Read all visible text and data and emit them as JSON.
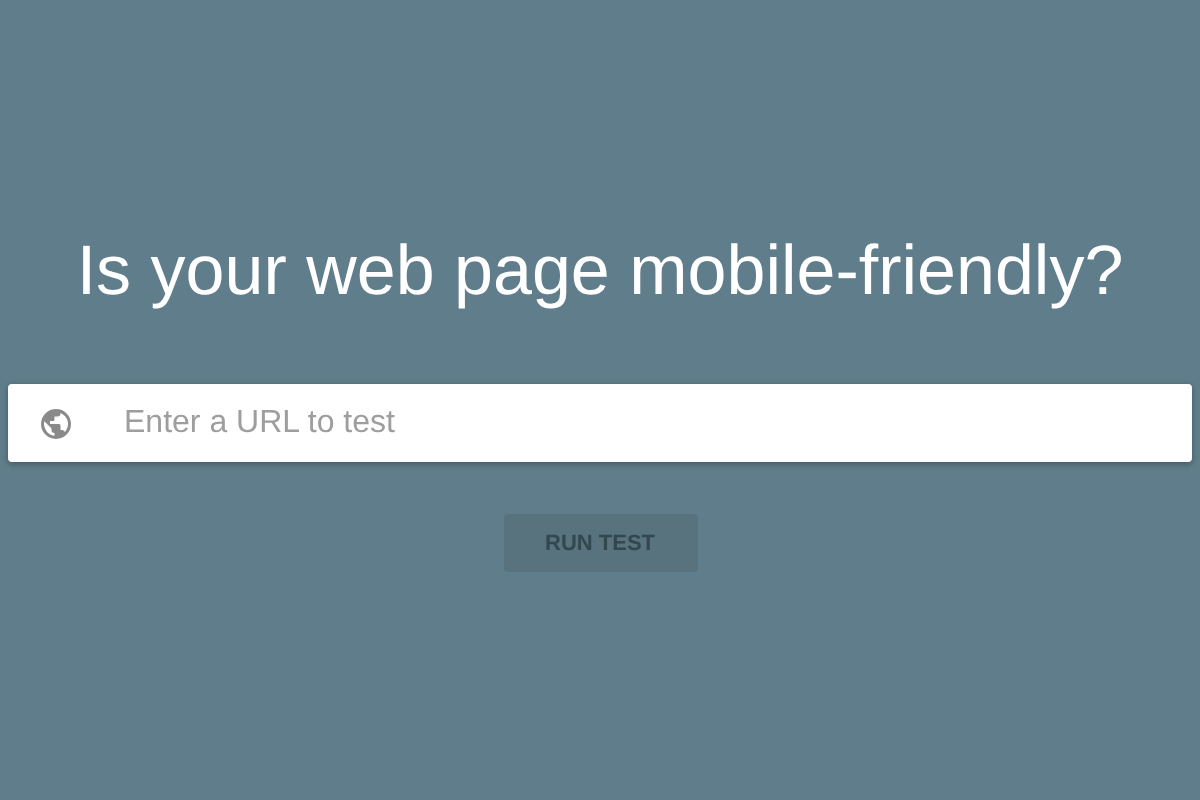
{
  "heading": "Is your web page mobile-friendly?",
  "url_field": {
    "placeholder": "Enter a URL to test"
  },
  "run_button": {
    "label": "RUN TEST",
    "disabled": true
  }
}
